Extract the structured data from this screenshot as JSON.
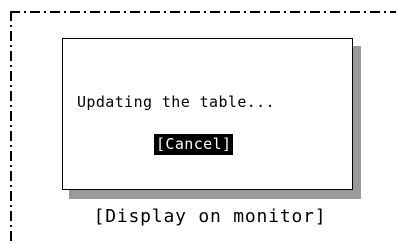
{
  "dialog": {
    "message": "Updating the table...",
    "cancel_label": "[Cancel]"
  },
  "caption": "[Display on monitor]",
  "colors": {
    "background": "#ffffff",
    "border": "#000000",
    "shadow": "#9a9a9a",
    "button_bg": "#000000",
    "button_text": "#ffffff"
  }
}
